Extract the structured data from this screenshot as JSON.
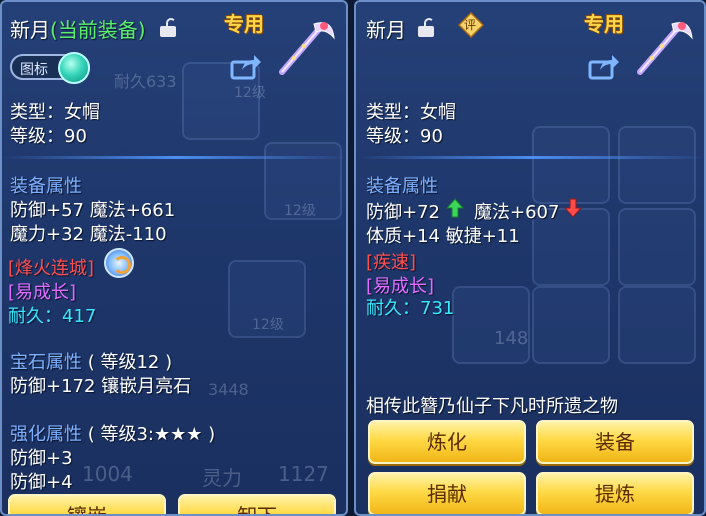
{
  "left_panel": {
    "title": "新月",
    "title_status": "(当前装备)",
    "special_label": "专用",
    "toggle_label": "图标",
    "type_line": "类型：女帽",
    "level_line": "等级：90",
    "equip_attr_header": "装备属性",
    "attr_line_1": "防御+57 魔法+661",
    "attr_line_2": "魔力+32 魔法-110",
    "special_effect": "[烽火连城]",
    "special_skill": "[易成长]",
    "durability_label": "耐久：",
    "durability_value": "417",
    "gem_header": "宝石属性",
    "gem_level": "( 等级12 )",
    "gem_line": "防御+172 镶嵌月亮石",
    "enhance_header": "强化属性",
    "enhance_level": "( 等级3:★★★ )",
    "enhance_line_1": "防御+3",
    "enhance_line_2": "防御+4",
    "button_inlay": "镶嵌",
    "button_unequip": "卸下",
    "ghost_texts": [
      "耐久633",
      "12级",
      "12级",
      "12级",
      "3448",
      "1004",
      "灵力",
      "1127"
    ]
  },
  "right_panel": {
    "title": "新月",
    "special_label": "专用",
    "eval_badge": "评",
    "type_line": "类型：女帽",
    "level_line": "等级：90",
    "equip_attr_header": "装备属性",
    "attr_defense": "防御+72",
    "attr_magic": "魔法+607",
    "attr_line_2": "体质+14 敏捷+11",
    "special_effect": "[疾速]",
    "special_skill": "[易成长]",
    "durability_label": "耐久：",
    "durability_value": "731",
    "description": "相传此簪乃仙子下凡时所遗之物",
    "button_refine": "炼化",
    "button_equip": "装备",
    "button_donate": "捐献",
    "button_purify": "提炼",
    "ghost_texts": [
      "148"
    ]
  },
  "colors": {
    "panel_bg": "#26427a",
    "section_blue": "#7fb0ff",
    "effect_red": "#ff4f4f",
    "skill_pink": "#e26cff",
    "durability_cyan": "#38e8ff",
    "button_gold": "#ffd945",
    "status_green": "#5cf06a"
  },
  "icons": {
    "lock": "lock-icon",
    "share": "share-icon",
    "weapon": "hairpin-weapon-icon",
    "up": "arrow-up-icon",
    "down": "arrow-down-icon",
    "eval": "evaluate-badge-icon",
    "ring": "effect-ring-icon"
  }
}
